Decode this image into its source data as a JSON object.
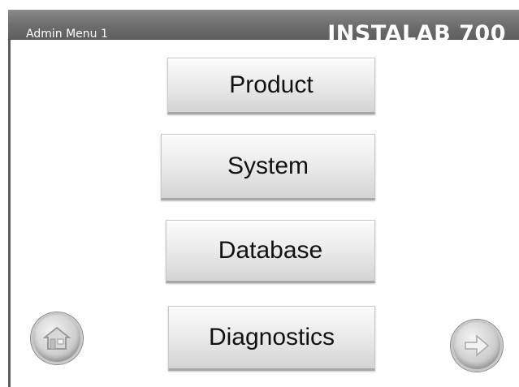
{
  "header": {
    "title": "Admin Menu 1",
    "brand": "INSTALAB 700"
  },
  "menu": {
    "items": [
      {
        "label": "Product"
      },
      {
        "label": "System"
      },
      {
        "label": "Database"
      },
      {
        "label": "Diagnostics"
      }
    ]
  },
  "nav": {
    "home_icon": "home-icon",
    "next_icon": "arrow-right-icon"
  },
  "colors": {
    "header_bg": "#6d6d6d",
    "header_text": "#ffffff",
    "button_face": "#ececec",
    "button_text": "#111111"
  }
}
